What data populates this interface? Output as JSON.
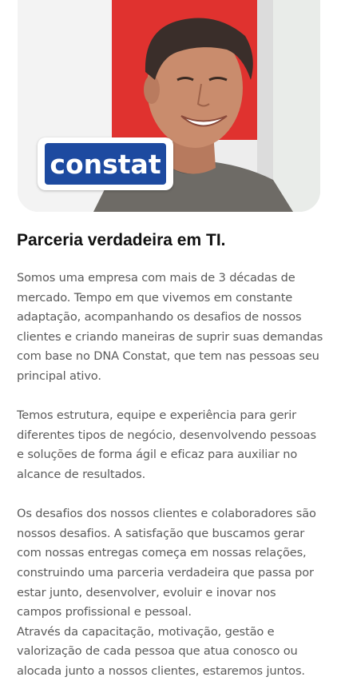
{
  "hero": {
    "logo_text": "constat",
    "colors": {
      "brand_blue": "#1d4aa0",
      "accent_red": "#e0322f"
    }
  },
  "section": {
    "title": "Parceria verdadeira em TI.",
    "paragraphs": [
      "Somos uma empresa com mais de 3 décadas de mercado. Tempo em que vivemos em constante adaptação, acompanhando os desafios de nossos clientes e criando maneiras de suprir suas demandas com base no DNA Constat, que tem nas pessoas seu principal ativo.",
      "Temos estrutura, equipe e experiência para gerir diferentes tipos de negócio, desenvolvendo pessoas e soluções de forma ágil e eficaz para auxiliar no alcance de resultados.",
      "Os desafios dos nossos clientes e colaboradores são nossos desafios. A satisfação que buscamos gerar com nossas entregas começa em nossas relações, construindo uma parceria verdadeira que passa por estar junto, desenvolver, evoluir e inovar nos campos profissional e pessoal.",
      "Através da capacitação, motivação, gestão e valorização de cada pessoa que atua conosco ou alocada junto a nossos clientes, estaremos juntos."
    ]
  }
}
